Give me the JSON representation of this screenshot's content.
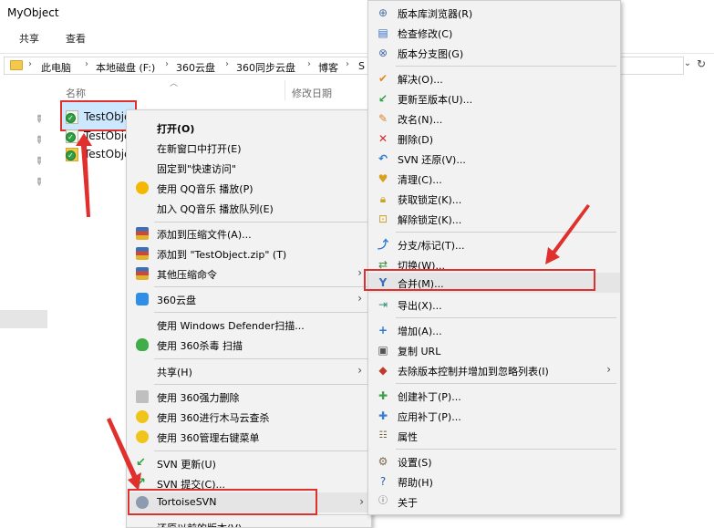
{
  "window": {
    "title": "MyObject"
  },
  "ribbon": {
    "tabs": [
      "共享",
      "查看"
    ]
  },
  "address": {
    "crumbs": [
      "此电脑",
      "本地磁盘 (F:)",
      "360云盘",
      "360同步云盘",
      "博客",
      "S"
    ],
    "separator": "›"
  },
  "columns": {
    "name": "名称",
    "modified": "修改日期"
  },
  "files": [
    {
      "name": "TestObje"
    },
    {
      "name": "TestObje"
    },
    {
      "name": "TestObje"
    }
  ],
  "menu1": {
    "items": [
      {
        "label": "打开(O)"
      },
      {
        "label": "在新窗口中打开(E)"
      },
      {
        "label": "固定到\"快速访问\""
      },
      {
        "label": "使用 QQ音乐 播放(P)"
      },
      {
        "label": "加入 QQ音乐 播放队列(E)"
      },
      {
        "label": "添加到压缩文件(A)..."
      },
      {
        "label": "添加到 \"TestObject.zip\" (T)"
      },
      {
        "label": "其他压缩命令"
      },
      {
        "label": "360云盘"
      },
      {
        "label": "使用 Windows Defender扫描..."
      },
      {
        "label": "使用 360杀毒 扫描"
      },
      {
        "label": "共享(H)"
      },
      {
        "label": "使用 360强力删除"
      },
      {
        "label": "使用 360进行木马云查杀"
      },
      {
        "label": "使用 360管理右键菜单"
      },
      {
        "label": "SVN 更新(U)"
      },
      {
        "label": "SVN 提交(C)..."
      },
      {
        "label": "TortoiseSVN"
      },
      {
        "label": "还原以前的版本(V)"
      }
    ],
    "submenu_arrow": "›"
  },
  "menu2": {
    "items": [
      {
        "label": "版本库浏览器(R)",
        "icon": "repo-browser-icon"
      },
      {
        "label": "检查修改(C)",
        "icon": "check-modifications-icon"
      },
      {
        "label": "版本分支图(G)",
        "icon": "revision-graph-icon"
      },
      {
        "label": "解决(O)...",
        "icon": "resolve-icon"
      },
      {
        "label": "更新至版本(U)...",
        "icon": "update-to-revision-icon"
      },
      {
        "label": "改名(N)...",
        "icon": "rename-icon"
      },
      {
        "label": "删除(D)",
        "icon": "delete-icon"
      },
      {
        "label": "SVN 还原(V)...",
        "icon": "revert-icon"
      },
      {
        "label": "清理(C)...",
        "icon": "cleanup-icon"
      },
      {
        "label": "获取锁定(K)...",
        "icon": "lock-icon"
      },
      {
        "label": "解除锁定(K)...",
        "icon": "unlock-icon"
      },
      {
        "label": "分支/标记(T)...",
        "icon": "branch-icon"
      },
      {
        "label": "切换(W)...",
        "icon": "switch-icon"
      },
      {
        "label": "合并(M)...",
        "icon": "merge-icon"
      },
      {
        "label": "导出(X)...",
        "icon": "export-icon"
      },
      {
        "label": "增加(A)...",
        "icon": "add-icon"
      },
      {
        "label": "复制 URL",
        "icon": "copy-url-icon"
      },
      {
        "label": "去除版本控制并增加到忽略列表(I)",
        "icon": "ignore-icon"
      },
      {
        "label": "创建补丁(P)...",
        "icon": "create-patch-icon"
      },
      {
        "label": "应用补丁(P)...",
        "icon": "apply-patch-icon"
      },
      {
        "label": "属性",
        "icon": "properties-icon"
      },
      {
        "label": "设置(S)",
        "icon": "settings-icon"
      },
      {
        "label": "帮助(H)",
        "icon": "help-icon"
      },
      {
        "label": "关于",
        "icon": "about-icon"
      }
    ]
  },
  "colors": {
    "highlight_red": "#e0302d",
    "selection_blue": "#cce8ff",
    "menu_bg": "#f2f2f2"
  }
}
